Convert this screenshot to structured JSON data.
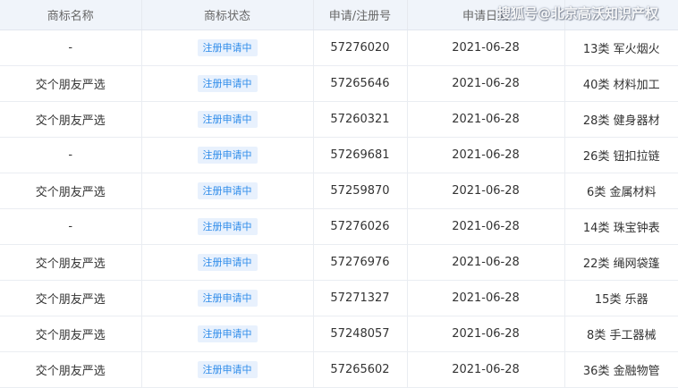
{
  "table": {
    "headers": [
      "商标名称",
      "商标状态",
      "申请/注册号",
      "申请日期",
      ""
    ],
    "rows": [
      {
        "name": "-",
        "status": "注册申请中",
        "reg_no": "57276020",
        "date": "2021-06-28",
        "category": "13类 军火烟火"
      },
      {
        "name": "交个朋友严选",
        "status": "注册申请中",
        "reg_no": "57265646",
        "date": "2021-06-28",
        "category": "40类 材料加工"
      },
      {
        "name": "交个朋友严选",
        "status": "注册申请中",
        "reg_no": "57260321",
        "date": "2021-06-28",
        "category": "28类 健身器材"
      },
      {
        "name": "-",
        "status": "注册申请中",
        "reg_no": "57269681",
        "date": "2021-06-28",
        "category": "26类 钮扣拉链"
      },
      {
        "name": "交个朋友严选",
        "status": "注册申请中",
        "reg_no": "57259870",
        "date": "2021-06-28",
        "category": "6类 金属材料"
      },
      {
        "name": "-",
        "status": "注册申请中",
        "reg_no": "57276026",
        "date": "2021-06-28",
        "category": "14类 珠宝钟表"
      },
      {
        "name": "交个朋友严选",
        "status": "注册申请中",
        "reg_no": "57276976",
        "date": "2021-06-28",
        "category": "22类 绳网袋篷"
      },
      {
        "name": "交个朋友严选",
        "status": "注册申请中",
        "reg_no": "57271327",
        "date": "2021-06-28",
        "category": "15类 乐器"
      },
      {
        "name": "交个朋友严选",
        "status": "注册申请中",
        "reg_no": "57248057",
        "date": "2021-06-28",
        "category": "8类 手工器械"
      },
      {
        "name": "交个朋友严选",
        "status": "注册申请中",
        "reg_no": "57265602",
        "date": "2021-06-28",
        "category": "36类 金融物管"
      }
    ]
  },
  "watermark": {
    "text": "搜狐号@北京高沃知识产权"
  },
  "colors": {
    "badge_text": "#2f8cea",
    "badge_bg": "#e8f1fd",
    "header_bg": "#f0f4fa"
  }
}
